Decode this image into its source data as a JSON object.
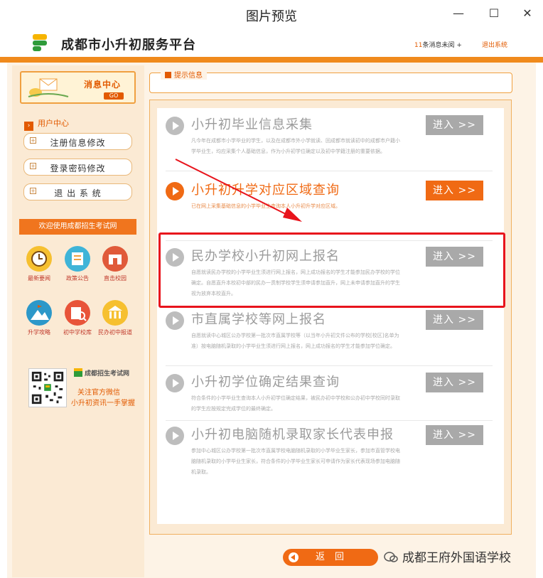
{
  "window": {
    "title": "图片预览",
    "minimize_icon": "minimize-icon",
    "maximize_icon": "maximize-icon",
    "close_icon": "close-icon"
  },
  "site": {
    "name": "成都市小升初服务平台",
    "message_count": "11",
    "message_suffix": "条消息未阅 +",
    "logout": "退出系统",
    "accent_color": "#f06a14"
  },
  "sidebar": {
    "message_center": "消息中心",
    "message_go": "GO",
    "user_center": "用户中心",
    "menu": [
      {
        "label": "注册信息修改"
      },
      {
        "label": "登录密码修改"
      },
      {
        "label": "退 出 系 统"
      }
    ],
    "welcome": "欢迎使用成都招生考试网",
    "quick_links": [
      {
        "label": "最新要闻",
        "icon": "clock-icon"
      },
      {
        "label": "政策公告",
        "icon": "notice-icon"
      },
      {
        "label": "直击校园",
        "icon": "school-icon"
      },
      {
        "label": "升学攻略",
        "icon": "mountain-icon"
      },
      {
        "label": "初中学校库",
        "icon": "search-library-icon"
      },
      {
        "label": "民办初中报道",
        "icon": "building-icon"
      }
    ],
    "qr_logo": "成都招生考试网",
    "qr_line1": "关注官方微信",
    "qr_line2": "小升初资讯一手掌握"
  },
  "tip": {
    "label": "提示信息"
  },
  "items": [
    {
      "title": "小升初毕业信息采集",
      "desc": "凡今年在成都市小学毕业的学生，以及在成都市外小学就读、回成都市就读初中的成都市户籍小学毕业生，均应采集个人基础信息，作为小升初学位确定以及初中学籍注册的重要依据。",
      "button": "进入 >>"
    },
    {
      "title": "小升初升学对应区域查询",
      "desc": "已在网上采集基础信息的小学毕业生查询本人小升初升学对应区域。",
      "button": "进入 >>"
    },
    {
      "title": "民办学校小升初网上报名",
      "desc": "自愿就读民办学校的小学毕业生须进行网上报名，网上成功报名的学生才能参加民办学校的学位确定。自愿直升本校初中部的民办一贯制学校学生须申请参加直升，网上未申请参加直升的学生视为放弃本校直升。",
      "button": "进入 >>"
    },
    {
      "title": "市直属学校等网上报名",
      "desc": "自愿就读中心城区公办学校第一批次市直属学校等（以当年小升初文件公布的学校[校区]名单为准）按电脑随机录取的小学毕业生须进行网上报名，网上成功报名的学生才能参加学位确定。",
      "button": "进入 >>"
    },
    {
      "title": "小升初学位确定结果查询",
      "desc": "符合条件的小学毕业生查询本人小升初学位确定结果，被民办初中学校和公办初中学校同时录取的学生应按规定完成学位的最终确定。",
      "button": "进入 >>"
    },
    {
      "title": "小升初电脑随机录取家长代表申报",
      "desc": "参加中心城区公办学校第一批次市直属学校电脑随机录取的小学毕业生家长，参加市直管学校电脑随机录取的小学毕业生家长，符合条件的小学毕业生家长可申请作为家长代表现场参加电脑随机录取。",
      "button": "进入 >>"
    }
  ],
  "back_button": "返回",
  "watermark": "成都王府外国语学校"
}
